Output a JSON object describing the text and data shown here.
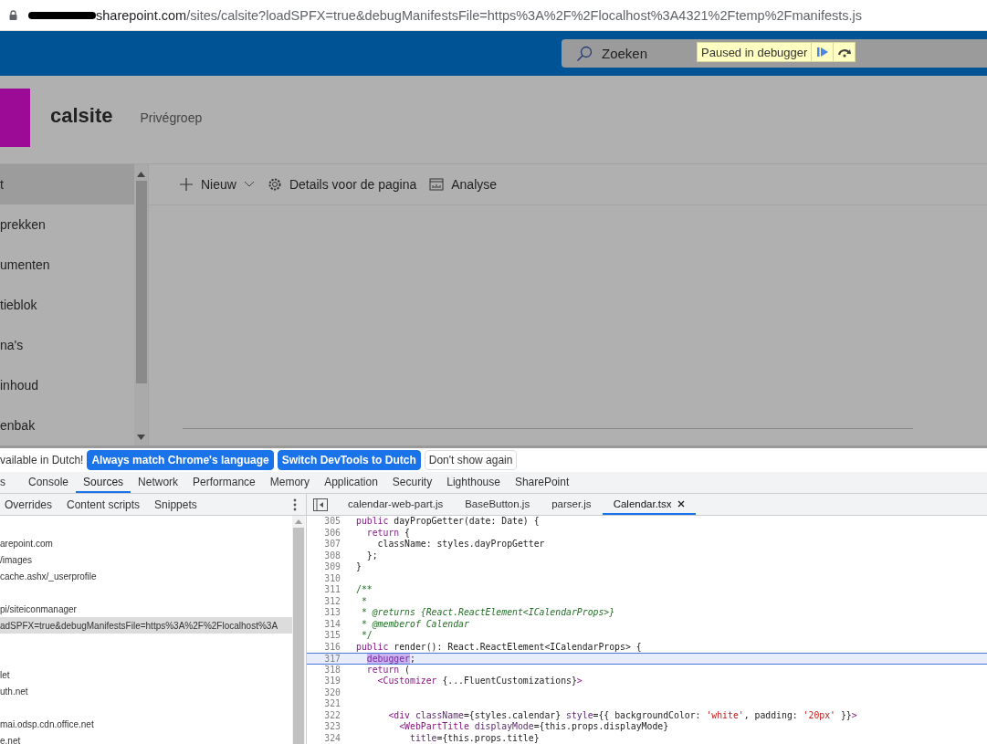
{
  "address_bar": {
    "url_host": "sharepoint.com",
    "url_path": "/sites/calsite?loadSPFX=true&debugManifestsFile=https%3A%2F%2Flocalhost%3A4321%2Ftemp%2Fmanifests.js"
  },
  "suite_bar": {
    "search_placeholder": "Zoeken",
    "debugger_banner": "Paused in debugger"
  },
  "site": {
    "title": "calsite",
    "privacy": "Privégroep"
  },
  "nav": {
    "items": [
      {
        "label": "t",
        "selected": true
      },
      {
        "label": "prekken",
        "selected": false
      },
      {
        "label": "umenten",
        "selected": false
      },
      {
        "label": "tieblok",
        "selected": false
      },
      {
        "label": "na's",
        "selected": false
      },
      {
        "label": "inhoud",
        "selected": false
      },
      {
        "label": "enbak",
        "selected": false
      }
    ]
  },
  "command_bar": [
    {
      "kind": "new",
      "label": "Nieuw"
    },
    {
      "kind": "details",
      "label": "Details voor de pagina"
    },
    {
      "kind": "analytics",
      "label": "Analyse"
    }
  ],
  "devtools": {
    "infobar": {
      "message": "vailable in Dutch!",
      "buttons": [
        {
          "kind": "primary",
          "label": "Always match Chrome's language"
        },
        {
          "kind": "primary",
          "label": "Switch DevTools to Dutch"
        },
        {
          "kind": "secondary",
          "label": "Don't show again"
        }
      ]
    },
    "tabs": [
      {
        "label": "s",
        "selected": false
      },
      {
        "label": "Console",
        "selected": false
      },
      {
        "label": "Sources",
        "selected": true
      },
      {
        "label": "Network",
        "selected": false
      },
      {
        "label": "Performance",
        "selected": false
      },
      {
        "label": "Memory",
        "selected": false
      },
      {
        "label": "Application",
        "selected": false
      },
      {
        "label": "Security",
        "selected": false
      },
      {
        "label": "Lighthouse",
        "selected": false
      },
      {
        "label": "SharePoint",
        "selected": false
      }
    ],
    "navigator_tabs": [
      "Overrides",
      "Content scripts",
      "Snippets"
    ],
    "file_tree": [
      {
        "kind": "blank"
      },
      {
        "kind": "entry",
        "label": "arepoint.com",
        "selected": false
      },
      {
        "kind": "entry",
        "label": "/images",
        "selected": false
      },
      {
        "kind": "entry",
        "label": "cache.ashx/_userprofile",
        "selected": false
      },
      {
        "kind": "blank"
      },
      {
        "kind": "entry",
        "label": "pi/siteiconmanager",
        "selected": false
      },
      {
        "kind": "entry",
        "label": "adSPFX=true&debugManifestsFile=https%3A%2F%2Flocalhost%3A",
        "selected": true
      },
      {
        "kind": "blank"
      },
      {
        "kind": "blank"
      },
      {
        "kind": "entry",
        "label": "let",
        "selected": false
      },
      {
        "kind": "entry",
        "label": "uth.net",
        "selected": false
      },
      {
        "kind": "blank"
      },
      {
        "kind": "entry",
        "label": "mai.odsp.cdn.office.net",
        "selected": false
      },
      {
        "kind": "entry",
        "label": "e.net",
        "selected": false
      }
    ],
    "editor_tabs": [
      {
        "label": "calendar-web-part.js",
        "selected": false,
        "closable": false
      },
      {
        "label": "BaseButton.js",
        "selected": false,
        "closable": false
      },
      {
        "label": "parser.js",
        "selected": false,
        "closable": false
      },
      {
        "label": "Calendar.tsx",
        "selected": true,
        "closable": true
      }
    ],
    "code": [
      {
        "number": "305",
        "paused": false,
        "tokens": [
          {
            "kind": "keyword",
            "text": "public"
          },
          {
            "kind": "plain",
            "text": " dayPropGetter(date: Date) {"
          }
        ]
      },
      {
        "number": "306",
        "paused": false,
        "tokens": [
          {
            "kind": "keyword",
            "text": "  return"
          },
          {
            "kind": "plain",
            "text": " {"
          }
        ]
      },
      {
        "number": "307",
        "paused": false,
        "tokens": [
          {
            "kind": "plain",
            "text": "    className: styles.dayPropGetter"
          }
        ]
      },
      {
        "number": "308",
        "paused": false,
        "tokens": [
          {
            "kind": "plain",
            "text": "  };"
          }
        ]
      },
      {
        "number": "309",
        "paused": false,
        "tokens": [
          {
            "kind": "plain",
            "text": "}"
          }
        ]
      },
      {
        "number": "310",
        "paused": false
      },
      {
        "number": "311",
        "paused": false,
        "tokens": [
          {
            "kind": "comment",
            "text": "/**"
          }
        ]
      },
      {
        "number": "312",
        "paused": false,
        "tokens": [
          {
            "kind": "comment",
            "text": " *"
          }
        ]
      },
      {
        "number": "313",
        "paused": false,
        "tokens": [
          {
            "kind": "comment",
            "text": " * "
          },
          {
            "kind": "doctag",
            "text": "@returns {React.ReactElement<ICalendarProps>}"
          }
        ]
      },
      {
        "number": "314",
        "paused": false,
        "tokens": [
          {
            "kind": "comment",
            "text": " * "
          },
          {
            "kind": "doctag",
            "text": "@memberof Calendar"
          }
        ]
      },
      {
        "number": "315",
        "paused": false,
        "tokens": [
          {
            "kind": "comment",
            "text": " */"
          }
        ]
      },
      {
        "number": "316",
        "paused": false,
        "tokens": [
          {
            "kind": "keyword",
            "text": "public"
          },
          {
            "kind": "plain",
            "text": " render(): React.ReactElement<ICalendarProps> {"
          }
        ]
      },
      {
        "number": "317",
        "paused": true,
        "tokens": [
          {
            "kind": "highlight",
            "text": "  debugger"
          },
          {
            "kind": "plain",
            "text": ";"
          }
        ]
      },
      {
        "number": "318",
        "paused": false,
        "tokens": [
          {
            "kind": "keyword",
            "text": "  return"
          },
          {
            "kind": "plain",
            "text": " ("
          }
        ]
      },
      {
        "number": "319",
        "paused": false,
        "tokens": [
          {
            "kind": "tag",
            "text": "    <Customizer"
          },
          {
            "kind": "plain",
            "text": " {...FluentCustomizations}"
          },
          {
            "kind": "tag",
            "text": ">"
          }
        ]
      },
      {
        "number": "320",
        "paused": false
      },
      {
        "number": "321",
        "paused": false
      },
      {
        "number": "322",
        "paused": false,
        "tokens": [
          {
            "kind": "tag",
            "text": "      <div"
          },
          {
            "kind": "attr",
            "text": " className"
          },
          {
            "kind": "plain",
            "text": "={styles.calendar} "
          },
          {
            "kind": "attr",
            "text": "style"
          },
          {
            "kind": "plain",
            "text": "={{ backgroundColor: "
          },
          {
            "kind": "string",
            "text": "'white'"
          },
          {
            "kind": "plain",
            "text": ", padding: "
          },
          {
            "kind": "string",
            "text": "'20px'"
          },
          {
            "kind": "plain",
            "text": " }}"
          },
          {
            "kind": "tag",
            "text": ">"
          }
        ]
      },
      {
        "number": "323",
        "paused": false,
        "tokens": [
          {
            "kind": "tag",
            "text": "        <WebPartTitle"
          },
          {
            "kind": "attr",
            "text": " displayMode"
          },
          {
            "kind": "plain",
            "text": "={this.props.displayMode}"
          }
        ]
      },
      {
        "number": "324",
        "paused": false,
        "tokens": [
          {
            "kind": "attr",
            "text": "          title"
          },
          {
            "kind": "plain",
            "text": "={this.props.title}"
          }
        ]
      }
    ]
  }
}
